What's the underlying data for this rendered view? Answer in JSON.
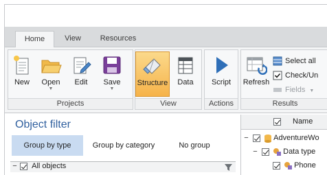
{
  "tabs": [
    {
      "label": "Home",
      "active": true
    },
    {
      "label": "View",
      "active": false
    },
    {
      "label": "Resources",
      "active": false
    }
  ],
  "groups": {
    "projects": {
      "label": "Projects",
      "buttons": [
        {
          "label": "New",
          "icon": "new-document-icon"
        },
        {
          "label": "Open",
          "icon": "folder-open-icon"
        },
        {
          "label": "Edit",
          "icon": "edit-document-icon"
        },
        {
          "label": "Save",
          "icon": "save-disk-icon"
        }
      ]
    },
    "view": {
      "label": "View",
      "buttons": [
        {
          "label": "Structure",
          "icon": "eraser-structure-icon",
          "active": true
        },
        {
          "label": "Data",
          "icon": "data-table-icon"
        }
      ]
    },
    "actions": {
      "label": "Actions",
      "buttons": [
        {
          "label": "Script",
          "icon": "play-script-icon"
        }
      ]
    },
    "results": {
      "label": "Results",
      "refresh": "Refresh",
      "select_all": "Select all",
      "check_uncheck": "Check/Un",
      "fields": "Fields"
    }
  },
  "object_filter": {
    "title": "Object filter",
    "segments": [
      "Group by type",
      "Group by category",
      "No group"
    ],
    "active_segment": 0,
    "tree_first_row": "All objects"
  },
  "results_grid": {
    "header_name": "Name",
    "rows": [
      "AdventureWo",
      "Data type",
      "Phone"
    ]
  },
  "colors": {
    "accent_title": "#2f5f9e",
    "active_button": "#f6b34a",
    "active_segment": "#c9dbf1"
  }
}
